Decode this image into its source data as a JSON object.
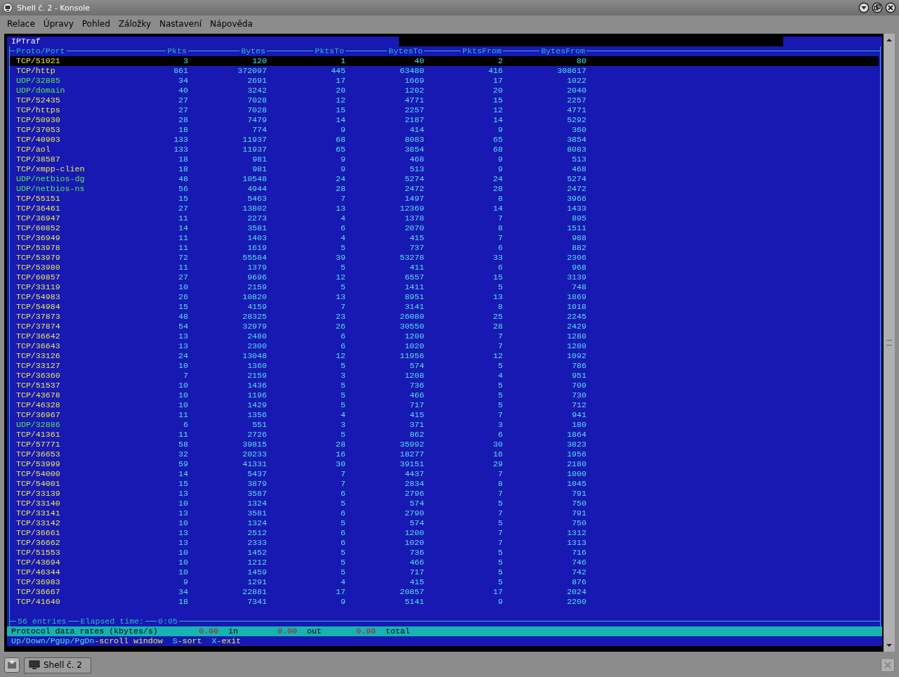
{
  "window": {
    "title": "Shell č. 2 - Konsole"
  },
  "menu": [
    "Relace",
    "Úpravy",
    "Pohled",
    "Záložky",
    "Nastavení",
    "Nápověda"
  ],
  "terminal": {
    "app_title": "IPTraf",
    "table": {
      "columns": [
        "Proto/Port",
        "Pkts",
        "Bytes",
        "PktsTo",
        "BytesTo",
        "PktsFrom",
        "BytesFrom"
      ],
      "rows": [
        {
          "proto": "TCP/51021",
          "pkts": "3",
          "bytes": "120",
          "pkts_to": "1",
          "bytes_to": "40",
          "pkts_from": "2",
          "bytes_from": "80",
          "kind": "tcp",
          "selected": true
        },
        {
          "proto": "TCP/http",
          "pkts": "861",
          "bytes": "372097",
          "pkts_to": "445",
          "bytes_to": "63480",
          "pkts_from": "416",
          "bytes_from": "308617",
          "kind": "tcp",
          "selected": false
        },
        {
          "proto": "UDP/32885",
          "pkts": "34",
          "bytes": "2691",
          "pkts_to": "17",
          "bytes_to": "1669",
          "pkts_from": "17",
          "bytes_from": "1022",
          "kind": "udp",
          "selected": false
        },
        {
          "proto": "UDP/domain",
          "pkts": "40",
          "bytes": "3242",
          "pkts_to": "20",
          "bytes_to": "1202",
          "pkts_from": "20",
          "bytes_from": "2040",
          "kind": "udp",
          "selected": false
        },
        {
          "proto": "TCP/52435",
          "pkts": "27",
          "bytes": "7028",
          "pkts_to": "12",
          "bytes_to": "4771",
          "pkts_from": "15",
          "bytes_from": "2257",
          "kind": "tcp",
          "selected": false
        },
        {
          "proto": "TCP/https",
          "pkts": "27",
          "bytes": "7028",
          "pkts_to": "15",
          "bytes_to": "2257",
          "pkts_from": "12",
          "bytes_from": "4771",
          "kind": "tcp",
          "selected": false
        },
        {
          "proto": "TCP/50930",
          "pkts": "28",
          "bytes": "7479",
          "pkts_to": "14",
          "bytes_to": "2187",
          "pkts_from": "14",
          "bytes_from": "5292",
          "kind": "tcp",
          "selected": false
        },
        {
          "proto": "TCP/37053",
          "pkts": "18",
          "bytes": "774",
          "pkts_to": "9",
          "bytes_to": "414",
          "pkts_from": "9",
          "bytes_from": "360",
          "kind": "tcp",
          "selected": false
        },
        {
          "proto": "TCP/40903",
          "pkts": "133",
          "bytes": "11937",
          "pkts_to": "68",
          "bytes_to": "8083",
          "pkts_from": "65",
          "bytes_from": "3854",
          "kind": "tcp",
          "selected": false
        },
        {
          "proto": "TCP/aol",
          "pkts": "133",
          "bytes": "11937",
          "pkts_to": "65",
          "bytes_to": "3854",
          "pkts_from": "68",
          "bytes_from": "8083",
          "kind": "tcp",
          "selected": false
        },
        {
          "proto": "TCP/38587",
          "pkts": "18",
          "bytes": "981",
          "pkts_to": "9",
          "bytes_to": "468",
          "pkts_from": "9",
          "bytes_from": "513",
          "kind": "tcp",
          "selected": false
        },
        {
          "proto": "TCP/xmpp-clien",
          "pkts": "18",
          "bytes": "981",
          "pkts_to": "9",
          "bytes_to": "513",
          "pkts_from": "9",
          "bytes_from": "468",
          "kind": "tcp",
          "selected": false
        },
        {
          "proto": "UDP/netbios-dg",
          "pkts": "48",
          "bytes": "10548",
          "pkts_to": "24",
          "bytes_to": "5274",
          "pkts_from": "24",
          "bytes_from": "5274",
          "kind": "udp",
          "selected": false
        },
        {
          "proto": "UDP/netbios-ns",
          "pkts": "56",
          "bytes": "4944",
          "pkts_to": "28",
          "bytes_to": "2472",
          "pkts_from": "28",
          "bytes_from": "2472",
          "kind": "udp",
          "selected": false
        },
        {
          "proto": "TCP/55151",
          "pkts": "15",
          "bytes": "5463",
          "pkts_to": "7",
          "bytes_to": "1497",
          "pkts_from": "8",
          "bytes_from": "3966",
          "kind": "tcp",
          "selected": false
        },
        {
          "proto": "TCP/36461",
          "pkts": "27",
          "bytes": "13802",
          "pkts_to": "13",
          "bytes_to": "12369",
          "pkts_from": "14",
          "bytes_from": "1433",
          "kind": "tcp",
          "selected": false
        },
        {
          "proto": "TCP/36947",
          "pkts": "11",
          "bytes": "2273",
          "pkts_to": "4",
          "bytes_to": "1378",
          "pkts_from": "7",
          "bytes_from": "895",
          "kind": "tcp",
          "selected": false
        },
        {
          "proto": "TCP/60852",
          "pkts": "14",
          "bytes": "3581",
          "pkts_to": "6",
          "bytes_to": "2070",
          "pkts_from": "8",
          "bytes_from": "1511",
          "kind": "tcp",
          "selected": false
        },
        {
          "proto": "TCP/36949",
          "pkts": "11",
          "bytes": "1403",
          "pkts_to": "4",
          "bytes_to": "415",
          "pkts_from": "7",
          "bytes_from": "988",
          "kind": "tcp",
          "selected": false
        },
        {
          "proto": "TCP/53978",
          "pkts": "11",
          "bytes": "1619",
          "pkts_to": "5",
          "bytes_to": "737",
          "pkts_from": "6",
          "bytes_from": "882",
          "kind": "tcp",
          "selected": false
        },
        {
          "proto": "TCP/53979",
          "pkts": "72",
          "bytes": "55584",
          "pkts_to": "39",
          "bytes_to": "53278",
          "pkts_from": "33",
          "bytes_from": "2306",
          "kind": "tcp",
          "selected": false
        },
        {
          "proto": "TCP/53980",
          "pkts": "11",
          "bytes": "1379",
          "pkts_to": "5",
          "bytes_to": "411",
          "pkts_from": "6",
          "bytes_from": "968",
          "kind": "tcp",
          "selected": false
        },
        {
          "proto": "TCP/60857",
          "pkts": "27",
          "bytes": "9696",
          "pkts_to": "12",
          "bytes_to": "6557",
          "pkts_from": "15",
          "bytes_from": "3139",
          "kind": "tcp",
          "selected": false
        },
        {
          "proto": "TCP/33119",
          "pkts": "10",
          "bytes": "2159",
          "pkts_to": "5",
          "bytes_to": "1411",
          "pkts_from": "5",
          "bytes_from": "748",
          "kind": "tcp",
          "selected": false
        },
        {
          "proto": "TCP/54983",
          "pkts": "26",
          "bytes": "10820",
          "pkts_to": "13",
          "bytes_to": "8951",
          "pkts_from": "13",
          "bytes_from": "1869",
          "kind": "tcp",
          "selected": false
        },
        {
          "proto": "TCP/54984",
          "pkts": "15",
          "bytes": "4159",
          "pkts_to": "7",
          "bytes_to": "3141",
          "pkts_from": "8",
          "bytes_from": "1018",
          "kind": "tcp",
          "selected": false
        },
        {
          "proto": "TCP/37873",
          "pkts": "48",
          "bytes": "28325",
          "pkts_to": "23",
          "bytes_to": "26080",
          "pkts_from": "25",
          "bytes_from": "2245",
          "kind": "tcp",
          "selected": false
        },
        {
          "proto": "TCP/37874",
          "pkts": "54",
          "bytes": "32979",
          "pkts_to": "26",
          "bytes_to": "30550",
          "pkts_from": "28",
          "bytes_from": "2429",
          "kind": "tcp",
          "selected": false
        },
        {
          "proto": "TCP/36642",
          "pkts": "13",
          "bytes": "2480",
          "pkts_to": "6",
          "bytes_to": "1200",
          "pkts_from": "7",
          "bytes_from": "1280",
          "kind": "tcp",
          "selected": false
        },
        {
          "proto": "TCP/36643",
          "pkts": "13",
          "bytes": "2300",
          "pkts_to": "6",
          "bytes_to": "1020",
          "pkts_from": "7",
          "bytes_from": "1280",
          "kind": "tcp",
          "selected": false
        },
        {
          "proto": "TCP/33126",
          "pkts": "24",
          "bytes": "13048",
          "pkts_to": "12",
          "bytes_to": "11956",
          "pkts_from": "12",
          "bytes_from": "1092",
          "kind": "tcp",
          "selected": false
        },
        {
          "proto": "TCP/33127",
          "pkts": "10",
          "bytes": "1360",
          "pkts_to": "5",
          "bytes_to": "574",
          "pkts_from": "5",
          "bytes_from": "786",
          "kind": "tcp",
          "selected": false
        },
        {
          "proto": "TCP/36360",
          "pkts": "7",
          "bytes": "2159",
          "pkts_to": "3",
          "bytes_to": "1208",
          "pkts_from": "4",
          "bytes_from": "951",
          "kind": "tcp",
          "selected": false
        },
        {
          "proto": "TCP/51537",
          "pkts": "10",
          "bytes": "1436",
          "pkts_to": "5",
          "bytes_to": "736",
          "pkts_from": "5",
          "bytes_from": "700",
          "kind": "tcp",
          "selected": false
        },
        {
          "proto": "TCP/43678",
          "pkts": "10",
          "bytes": "1196",
          "pkts_to": "5",
          "bytes_to": "466",
          "pkts_from": "5",
          "bytes_from": "730",
          "kind": "tcp",
          "selected": false
        },
        {
          "proto": "TCP/46328",
          "pkts": "10",
          "bytes": "1429",
          "pkts_to": "5",
          "bytes_to": "717",
          "pkts_from": "5",
          "bytes_from": "712",
          "kind": "tcp",
          "selected": false
        },
        {
          "proto": "TCP/36967",
          "pkts": "11",
          "bytes": "1356",
          "pkts_to": "4",
          "bytes_to": "415",
          "pkts_from": "7",
          "bytes_from": "941",
          "kind": "tcp",
          "selected": false
        },
        {
          "proto": "UDP/32886",
          "pkts": "6",
          "bytes": "551",
          "pkts_to": "3",
          "bytes_to": "371",
          "pkts_from": "3",
          "bytes_from": "180",
          "kind": "udp",
          "selected": false
        },
        {
          "proto": "TCP/41361",
          "pkts": "11",
          "bytes": "2726",
          "pkts_to": "5",
          "bytes_to": "862",
          "pkts_from": "6",
          "bytes_from": "1864",
          "kind": "tcp",
          "selected": false
        },
        {
          "proto": "TCP/57771",
          "pkts": "58",
          "bytes": "39815",
          "pkts_to": "28",
          "bytes_to": "35992",
          "pkts_from": "30",
          "bytes_from": "3823",
          "kind": "tcp",
          "selected": false
        },
        {
          "proto": "TCP/36653",
          "pkts": "32",
          "bytes": "20233",
          "pkts_to": "16",
          "bytes_to": "18277",
          "pkts_from": "16",
          "bytes_from": "1956",
          "kind": "tcp",
          "selected": false
        },
        {
          "proto": "TCP/53999",
          "pkts": "59",
          "bytes": "41331",
          "pkts_to": "30",
          "bytes_to": "39151",
          "pkts_from": "29",
          "bytes_from": "2180",
          "kind": "tcp",
          "selected": false
        },
        {
          "proto": "TCP/54000",
          "pkts": "14",
          "bytes": "5437",
          "pkts_to": "7",
          "bytes_to": "4437",
          "pkts_from": "7",
          "bytes_from": "1000",
          "kind": "tcp",
          "selected": false
        },
        {
          "proto": "TCP/54001",
          "pkts": "15",
          "bytes": "3879",
          "pkts_to": "7",
          "bytes_to": "2834",
          "pkts_from": "8",
          "bytes_from": "1045",
          "kind": "tcp",
          "selected": false
        },
        {
          "proto": "TCP/33139",
          "pkts": "13",
          "bytes": "3587",
          "pkts_to": "6",
          "bytes_to": "2796",
          "pkts_from": "7",
          "bytes_from": "791",
          "kind": "tcp",
          "selected": false
        },
        {
          "proto": "TCP/33140",
          "pkts": "10",
          "bytes": "1324",
          "pkts_to": "5",
          "bytes_to": "574",
          "pkts_from": "5",
          "bytes_from": "750",
          "kind": "tcp",
          "selected": false
        },
        {
          "proto": "TCP/33141",
          "pkts": "13",
          "bytes": "3581",
          "pkts_to": "6",
          "bytes_to": "2790",
          "pkts_from": "7",
          "bytes_from": "791",
          "kind": "tcp",
          "selected": false
        },
        {
          "proto": "TCP/33142",
          "pkts": "10",
          "bytes": "1324",
          "pkts_to": "5",
          "bytes_to": "574",
          "pkts_from": "5",
          "bytes_from": "750",
          "kind": "tcp",
          "selected": false
        },
        {
          "proto": "TCP/36661",
          "pkts": "13",
          "bytes": "2512",
          "pkts_to": "6",
          "bytes_to": "1200",
          "pkts_from": "7",
          "bytes_from": "1312",
          "kind": "tcp",
          "selected": false
        },
        {
          "proto": "TCP/36662",
          "pkts": "13",
          "bytes": "2333",
          "pkts_to": "6",
          "bytes_to": "1020",
          "pkts_from": "7",
          "bytes_from": "1313",
          "kind": "tcp",
          "selected": false
        },
        {
          "proto": "TCP/51553",
          "pkts": "10",
          "bytes": "1452",
          "pkts_to": "5",
          "bytes_to": "736",
          "pkts_from": "5",
          "bytes_from": "716",
          "kind": "tcp",
          "selected": false
        },
        {
          "proto": "TCP/43694",
          "pkts": "10",
          "bytes": "1212",
          "pkts_to": "5",
          "bytes_to": "466",
          "pkts_from": "5",
          "bytes_from": "746",
          "kind": "tcp",
          "selected": false
        },
        {
          "proto": "TCP/46344",
          "pkts": "10",
          "bytes": "1459",
          "pkts_to": "5",
          "bytes_to": "717",
          "pkts_from": "5",
          "bytes_from": "742",
          "kind": "tcp",
          "selected": false
        },
        {
          "proto": "TCP/36983",
          "pkts": "9",
          "bytes": "1291",
          "pkts_to": "4",
          "bytes_to": "415",
          "pkts_from": "5",
          "bytes_from": "876",
          "kind": "tcp",
          "selected": false
        },
        {
          "proto": "TCP/36667",
          "pkts": "34",
          "bytes": "22881",
          "pkts_to": "17",
          "bytes_to": "20857",
          "pkts_from": "17",
          "bytes_from": "2024",
          "kind": "tcp",
          "selected": false
        },
        {
          "proto": "TCP/41640",
          "pkts": "18",
          "bytes": "7341",
          "pkts_to": "9",
          "bytes_to": "5141",
          "pkts_from": "9",
          "bytes_from": "2200",
          "kind": "tcp",
          "selected": false
        }
      ]
    },
    "footer": {
      "entries": "56 entries",
      "elapsed_label": "Elapsed time:",
      "elapsed": "0:05"
    },
    "rates": {
      "label": "Protocol data rates (kbytes/s)",
      "items": [
        {
          "value": "0.00",
          "unit": "in"
        },
        {
          "value": "0.00",
          "unit": "out"
        },
        {
          "value": "0.00",
          "unit": "total"
        }
      ]
    },
    "hints": [
      {
        "key": "Up/Down/PgUp/PgDn",
        "action": "-scroll window"
      },
      {
        "key": "S",
        "action": "-sort"
      },
      {
        "key": "X",
        "action": "-exit"
      }
    ]
  },
  "taskbar": {
    "tabs": [
      {
        "label": "Shell č. 2",
        "selected": true
      }
    ]
  }
}
